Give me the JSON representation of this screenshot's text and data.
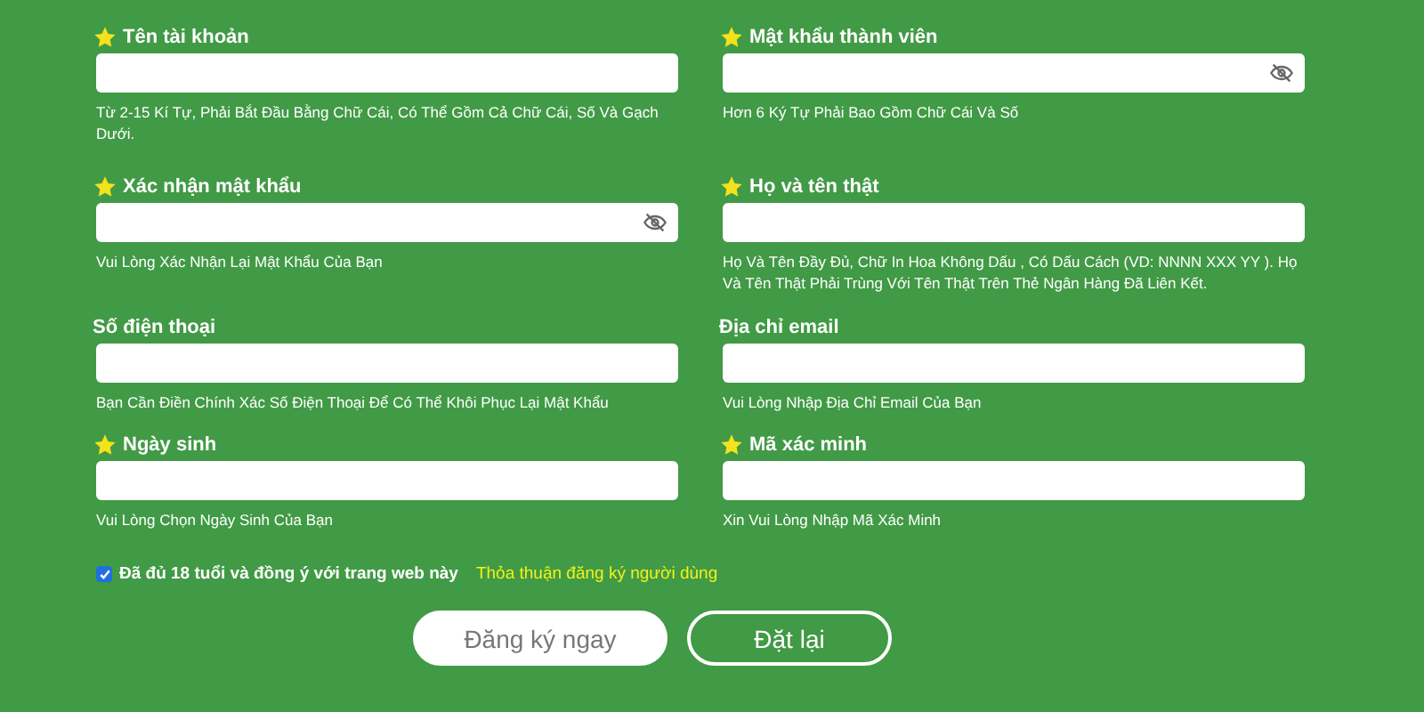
{
  "fields": [
    {
      "label": "Tên tài khoản",
      "required": true,
      "kind": "text",
      "hint": "Từ 2-15 Kí Tự, Phải Bắt Đầu Bằng Chữ Cái, Có Thể Gồm Cả Chữ Cái, Số Và Gạch Dưới."
    },
    {
      "label": "Mật khẩu thành viên",
      "required": true,
      "kind": "password",
      "hint": "Hơn 6 Ký Tự Phải Bao Gồm Chữ Cái Và Số"
    },
    {
      "label": "Xác nhận mật khẩu",
      "required": true,
      "kind": "password",
      "hint": "Vui Lòng Xác Nhận Lại Mật Khẩu Của Bạn"
    },
    {
      "label": "Họ và tên thật",
      "required": true,
      "kind": "text",
      "hint": "Họ Và Tên Đầy Đủ, Chữ In Hoa Không Dấu , Có Dấu Cách (VD: NNNN XXX YY ). Họ Và Tên Thật Phải Trùng Với Tên Thật Trên Thẻ Ngân Hàng Đã Liên Kết."
    },
    {
      "label": "Số điện thoại",
      "required": false,
      "kind": "text",
      "hint": "Bạn Cần Điền Chính Xác Số Điện Thoại Để Có Thể Khôi Phục Lại Mật Khẩu"
    },
    {
      "label": "Địa chỉ email",
      "required": false,
      "kind": "text",
      "hint": "Vui Lòng Nhập Địa Chỉ Email Của Bạn"
    },
    {
      "label": "Ngày sinh",
      "required": true,
      "kind": "text",
      "hint": "Vui Lòng Chọn Ngày Sinh Của Bạn"
    },
    {
      "label": "Mã xác minh",
      "required": true,
      "kind": "text",
      "hint": "Xin Vui Lòng Nhập Mã Xác Minh"
    }
  ],
  "agreement": {
    "checked": true,
    "label": "Đã đủ 18 tuổi và đồng ý với trang web này",
    "link": "Thỏa thuận đăng ký người dùng"
  },
  "buttons": [
    {
      "label": "Đăng ký ngay",
      "kind": "primary"
    },
    {
      "label": "Đặt lại",
      "kind": "outline"
    }
  ]
}
